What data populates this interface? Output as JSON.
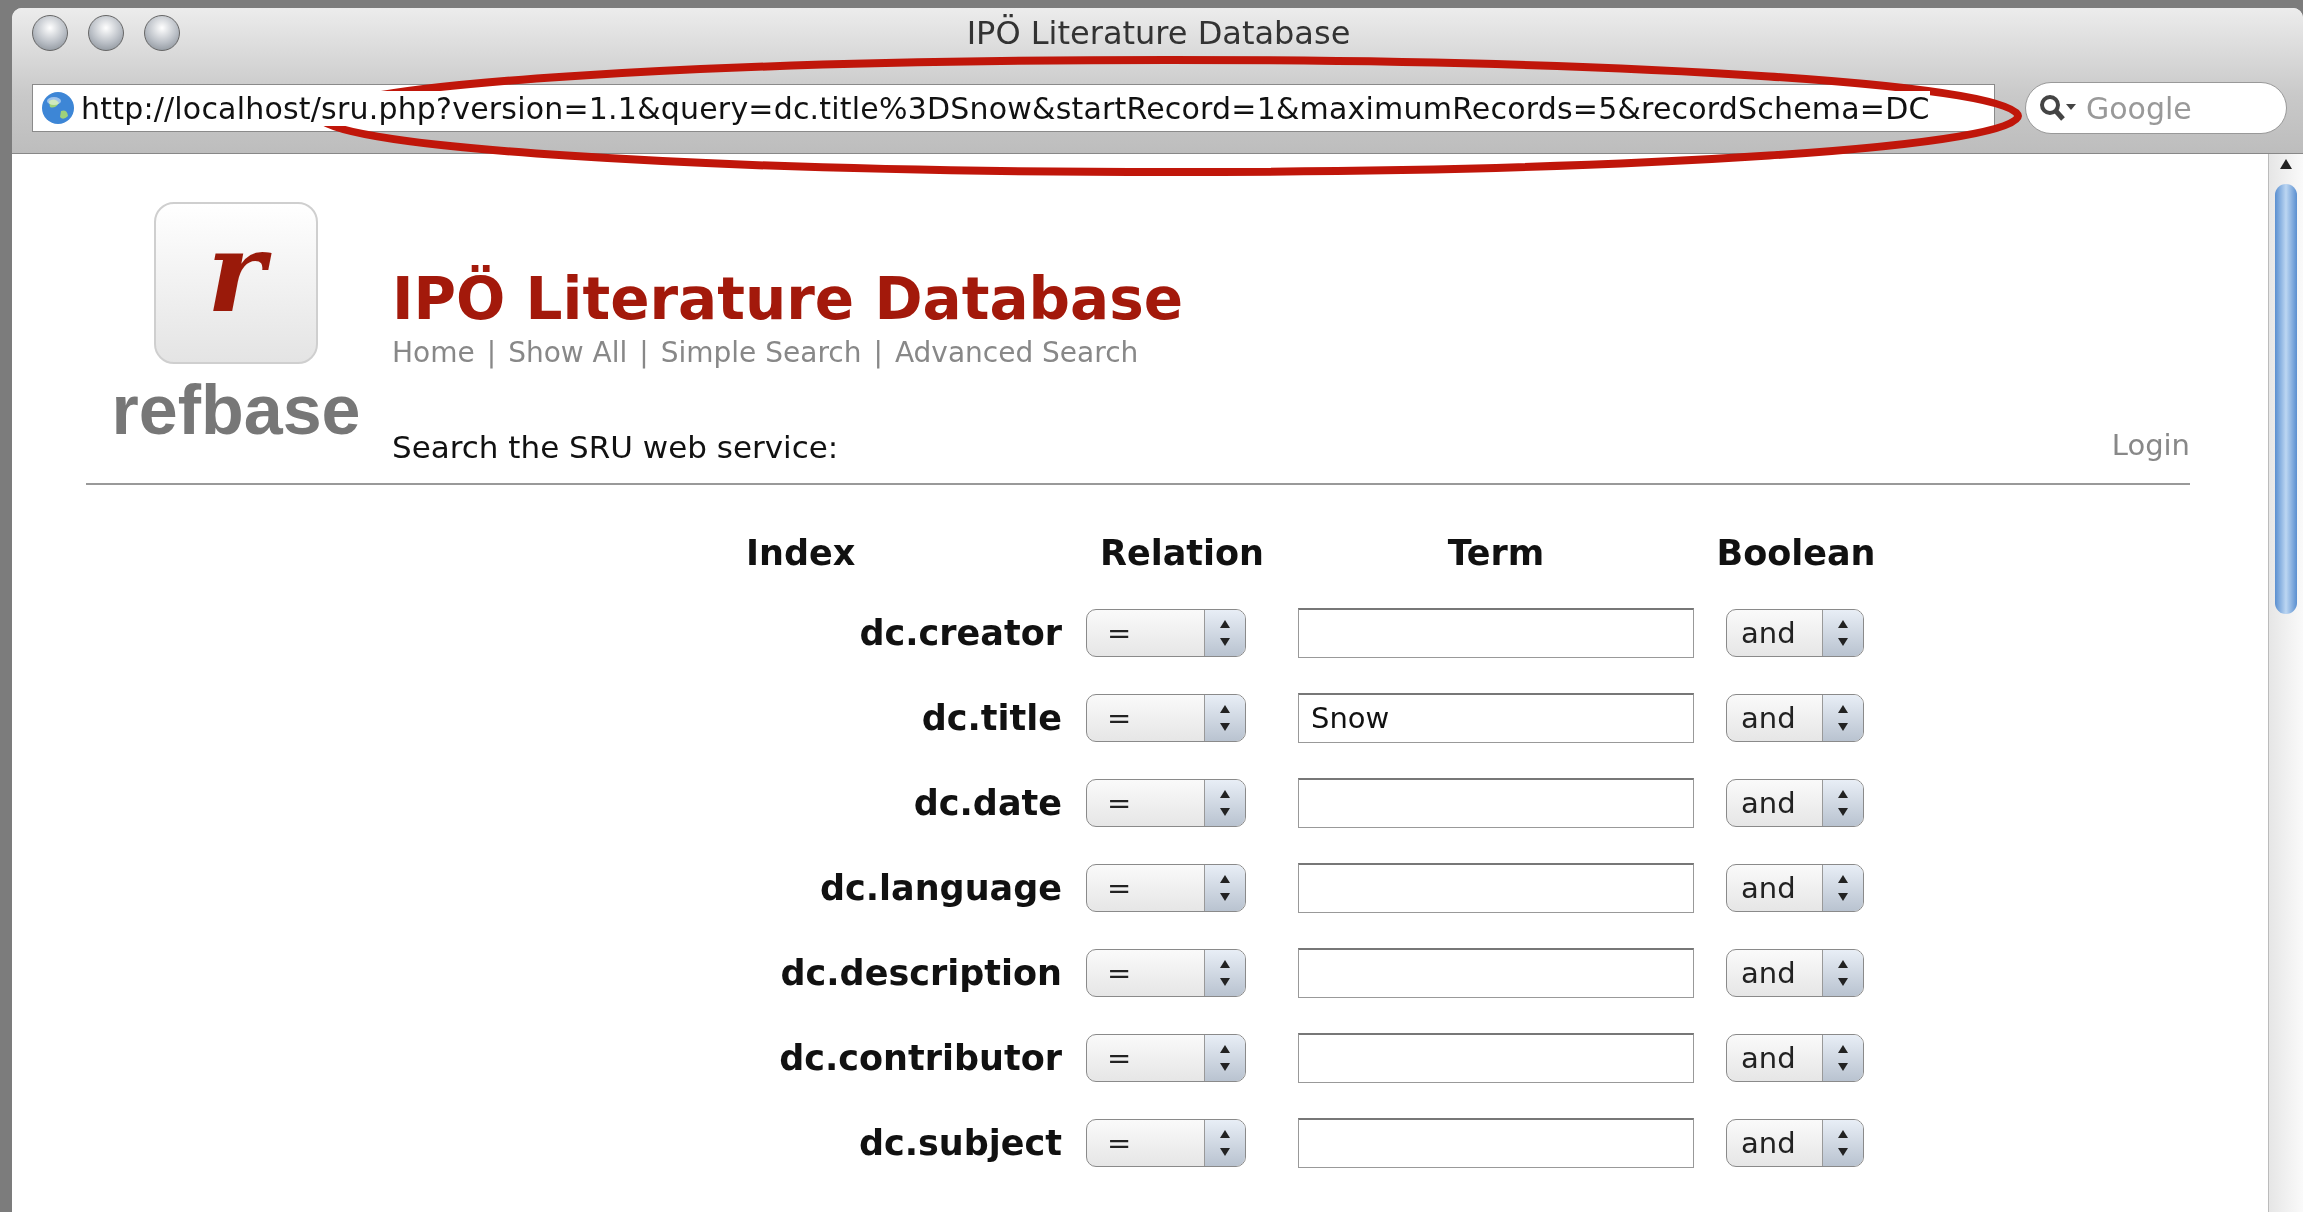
{
  "window": {
    "title": "IPÖ Literature Database"
  },
  "address_bar": {
    "url": "http://localhost/sru.php?version=1.1&query=dc.title%3DSnow&startRecord=1&maximumRecords=5&recordSchema=DC"
  },
  "search": {
    "placeholder": "Google"
  },
  "annotation": {
    "color": "#c0160a"
  },
  "logo": {
    "letter": "r",
    "name": "refbase"
  },
  "site_title": "IPÖ Literature Database",
  "nav": {
    "separator": "|",
    "links": [
      "Home",
      "Show All",
      "Simple Search",
      "Advanced Search"
    ]
  },
  "intro": "Search the SRU web service:",
  "login": "Login",
  "table": {
    "columns": [
      "Index",
      "Relation",
      "Term",
      "Boolean"
    ],
    "rows": [
      {
        "index": "dc.creator",
        "relation": "=",
        "term": "",
        "boolean": "and"
      },
      {
        "index": "dc.title",
        "relation": "=",
        "term": "Snow",
        "boolean": "and"
      },
      {
        "index": "dc.date",
        "relation": "=",
        "term": "",
        "boolean": "and"
      },
      {
        "index": "dc.language",
        "relation": "=",
        "term": "",
        "boolean": "and"
      },
      {
        "index": "dc.description",
        "relation": "=",
        "term": "",
        "boolean": "and"
      },
      {
        "index": "dc.contributor",
        "relation": "=",
        "term": "",
        "boolean": "and"
      },
      {
        "index": "dc.subject",
        "relation": "=",
        "term": "",
        "boolean": "and"
      }
    ]
  }
}
